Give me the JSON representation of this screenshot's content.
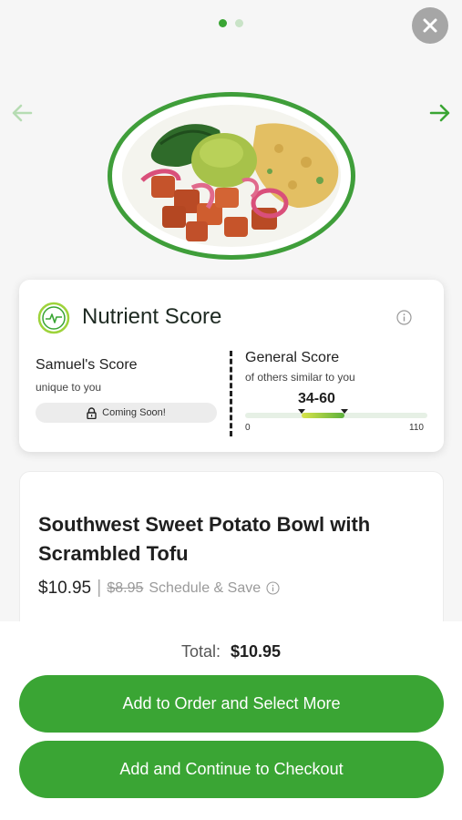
{
  "carousel": {
    "pages": 2,
    "active": 0
  },
  "icons": {
    "close": "close-icon",
    "prev": "arrow-left-icon",
    "next": "arrow-right-icon",
    "logo": "pulse-circle-icon",
    "info": "info-icon",
    "lock": "lock-icon"
  },
  "colors": {
    "accent": "#3aa534",
    "accent_light": "#c9e3c7",
    "close_bg": "#a6a6a6"
  },
  "nutrient_score": {
    "title": "Nutrient Score",
    "personal": {
      "title": "Samuel's Score",
      "subtitle": "unique to you",
      "badge": "Coming Soon!"
    },
    "general": {
      "title": "General Score",
      "subtitle": "of others similar to you",
      "range_label": "34-60",
      "range": [
        34,
        60
      ],
      "axis_min": "0",
      "axis_max": "110"
    }
  },
  "product": {
    "name": "Southwest Sweet Potato Bowl with Scrambled Tofu",
    "price": "$10.95",
    "separator": "|",
    "compare_price": "$8.95",
    "schedule_label": "Schedule & Save"
  },
  "footer": {
    "total_label": "Total:",
    "total_value": "$10.95",
    "primary_button": "Add to Order and Select More",
    "secondary_button": "Add and Continue to Checkout"
  }
}
